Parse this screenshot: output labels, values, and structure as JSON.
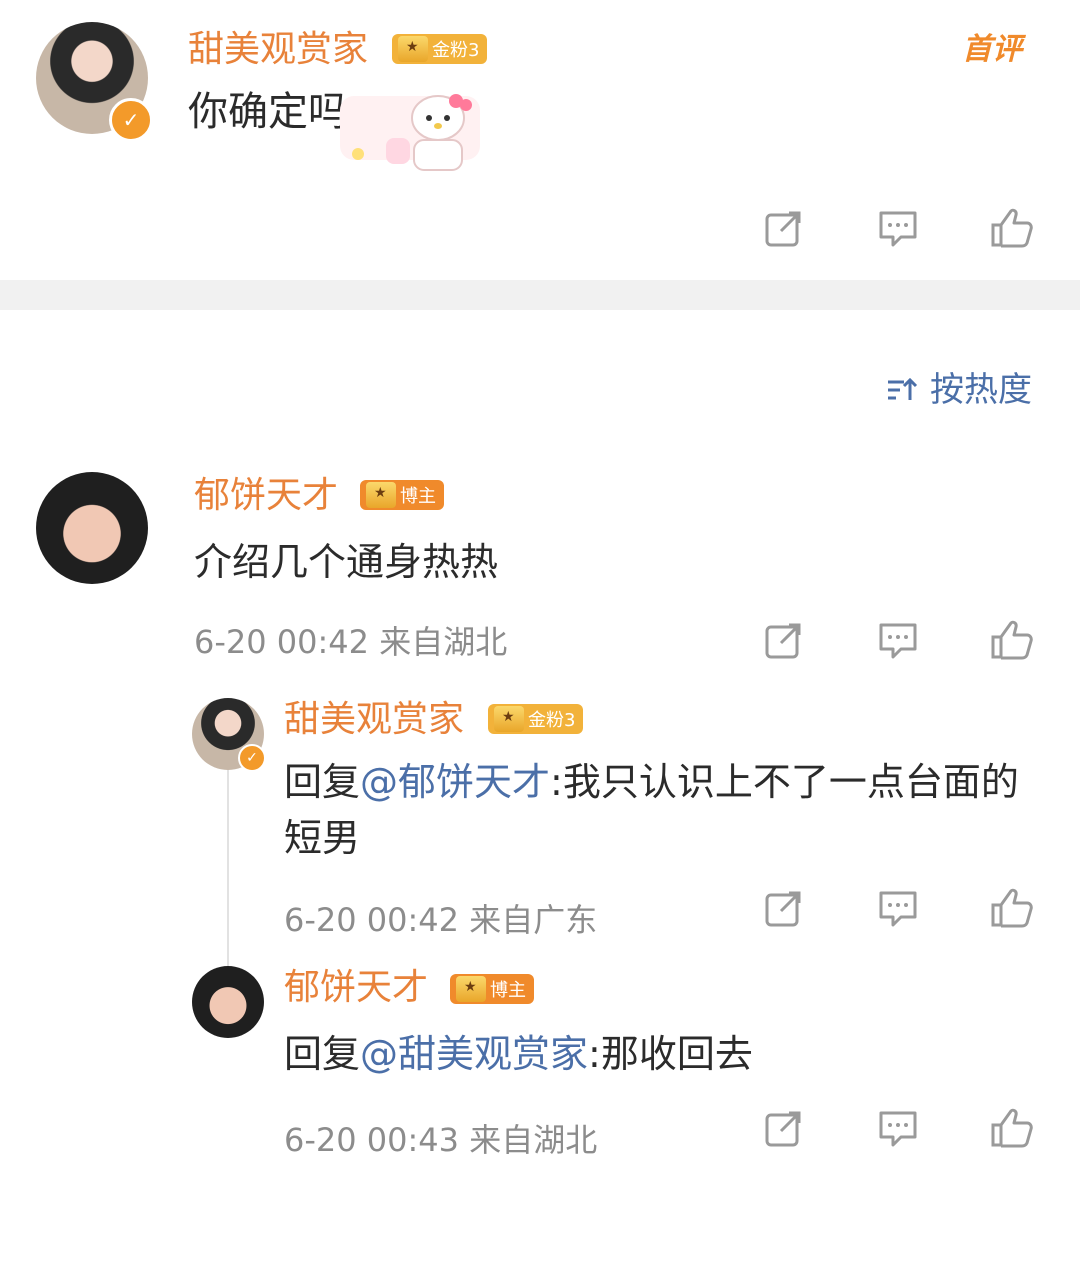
{
  "top_comment": {
    "username": "甜美观赏家",
    "badge_text": "金粉3",
    "first_comment_tag": "首评",
    "text": "你确定吗"
  },
  "sort": {
    "label": "按热度"
  },
  "comments": [
    {
      "username": "郁饼天才",
      "badge_text": "博主",
      "text": "介绍几个通身热热",
      "meta": "6-20 00:42 来自湖北"
    }
  ],
  "replies": [
    {
      "username": "甜美观赏家",
      "badge_text": "金粉3",
      "reply_prefix": "回复",
      "mention": "@郁饼天才",
      "text": ":我只认识上不了一点台面的短男",
      "meta": "6-20 00:42 来自广东"
    },
    {
      "username": "郁饼天才",
      "badge_text": "博主",
      "reply_prefix": "回复",
      "mention": "@甜美观赏家",
      "text": ":那收回去",
      "meta": "6-20 00:43 来自湖北"
    }
  ],
  "colors": {
    "name": "#e8823a",
    "mention": "#4b6fa8",
    "meta": "#8c8c8c",
    "badge_gold": "#f2b23a",
    "badge_orange": "#f08a2b",
    "separator": "#f1f1f1"
  },
  "icons": [
    "share-icon",
    "comment-icon",
    "like-icon",
    "sort-icon",
    "verified-icon"
  ]
}
